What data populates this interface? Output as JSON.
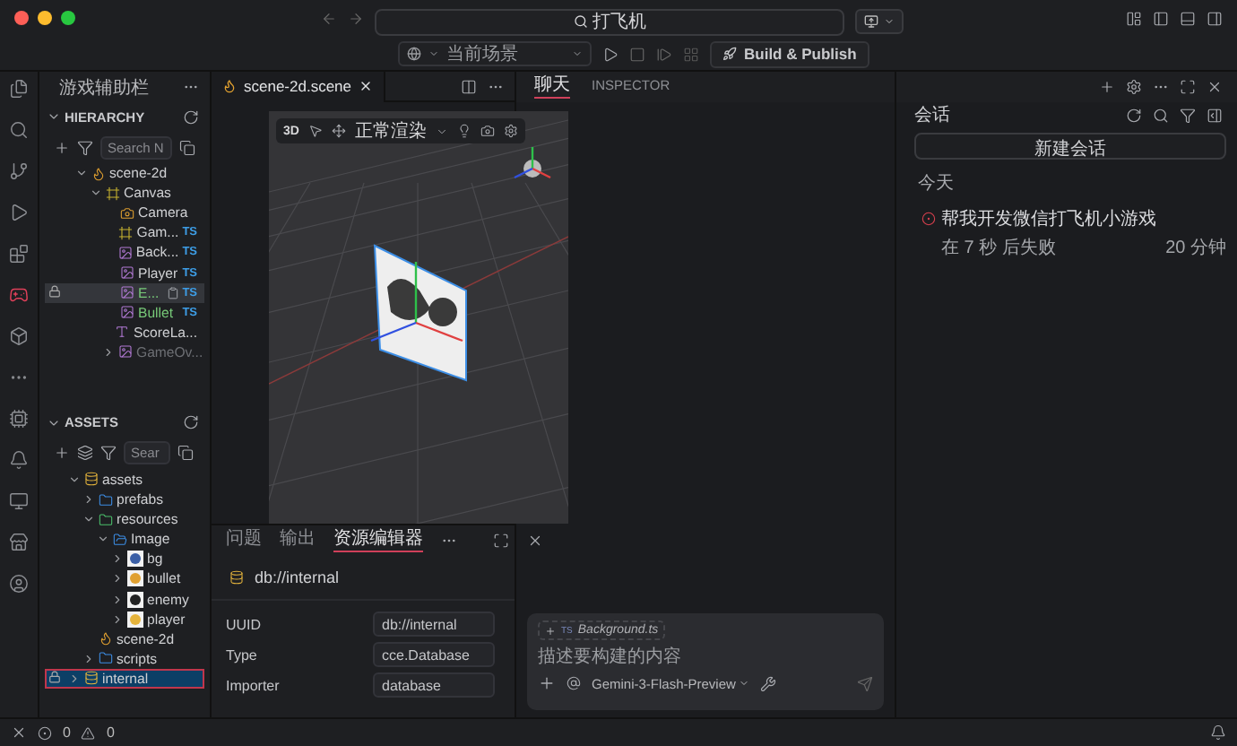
{
  "window": {
    "search": "打飞机"
  },
  "toolbar": {
    "scene_select": "当前场景",
    "build_button": "Build & Publish"
  },
  "activity_bar": [
    {
      "kind": "files",
      "selected": false
    },
    {
      "kind": "search",
      "selected": false
    },
    {
      "kind": "source",
      "selected": false
    },
    {
      "kind": "run",
      "selected": false
    },
    {
      "kind": "extensions",
      "selected": false
    },
    {
      "kind": "game",
      "selected": true
    },
    {
      "kind": "cube",
      "selected": false
    },
    {
      "kind": "more",
      "selected": false
    },
    {
      "kind": "chip",
      "selected": false
    },
    {
      "kind": "bell",
      "selected": false
    },
    {
      "kind": "monitor",
      "selected": false
    },
    {
      "kind": "store",
      "selected": false
    },
    {
      "kind": "account",
      "selected": false
    }
  ],
  "side_panel": {
    "title": "游戏辅助栏"
  },
  "hierarchy": {
    "title": "HIERARCHY",
    "search_placeholder": "Search N",
    "nodes": [
      {
        "label": "scene-2d",
        "kind": "scene",
        "expanded": true,
        "selected": false,
        "prefab": false,
        "active": true,
        "children": [
          {
            "label": "Canvas",
            "kind": "canvas",
            "expanded": true,
            "selected": false,
            "prefab": false,
            "active": true,
            "children": [
              {
                "label": "Camera",
                "kind": "camera",
                "selected": false,
                "prefab": false,
                "active": true
              },
              {
                "label": "Gam...",
                "kind": "canvas",
                "selected": false,
                "prefab": false,
                "active": true,
                "badge": "TS"
              },
              {
                "label": "Back...",
                "kind": "sprite",
                "selected": false,
                "prefab": false,
                "active": true,
                "badge": "TS"
              },
              {
                "label": "Player",
                "kind": "sprite",
                "selected": false,
                "prefab": false,
                "active": true,
                "badge": "TS"
              },
              {
                "label": "E...",
                "kind": "sprite",
                "selected": true,
                "prefab": true,
                "active": true,
                "badge": "TS"
              },
              {
                "label": "Bullet",
                "kind": "sprite",
                "selected": false,
                "prefab": true,
                "active": true,
                "badge": "TS"
              },
              {
                "label": "ScoreLa...",
                "kind": "label",
                "selected": false,
                "prefab": false,
                "active": true
              },
              {
                "label": "GameOv...",
                "kind": "sprite",
                "expanded": false,
                "selected": false,
                "prefab": false,
                "active": false
              }
            ]
          }
        ]
      }
    ]
  },
  "assets": {
    "title": "ASSETS",
    "search_placeholder": "Sear",
    "nodes": [
      {
        "label": "assets",
        "kind": "db",
        "expanded": true,
        "selected": false,
        "children": [
          {
            "label": "prefabs",
            "kind": "folder",
            "expanded": false,
            "selected": false
          },
          {
            "label": "resources",
            "kind": "folder-res",
            "expanded": true,
            "selected": false,
            "children": [
              {
                "label": "Image",
                "kind": "folder-open",
                "expanded": true,
                "selected": false,
                "children": [
                  {
                    "label": "bg",
                    "kind": "tex-planet",
                    "expanded": false,
                    "selected": false
                  },
                  {
                    "label": "bullet",
                    "kind": "tex-bullet",
                    "expanded": false,
                    "selected": false
                  },
                  {
                    "label": "enemy",
                    "kind": "tex-enemy",
                    "expanded": false,
                    "selected": false
                  },
                  {
                    "label": "player",
                    "kind": "tex-player",
                    "expanded": false,
                    "selected": false
                  }
                ]
              }
            ]
          },
          {
            "label": "scene-2d",
            "kind": "scene",
            "selected": false
          },
          {
            "label": "scripts",
            "kind": "folder",
            "expanded": false,
            "selected": false
          }
        ]
      },
      {
        "label": "internal",
        "kind": "db",
        "expanded": false,
        "selected": true
      }
    ]
  },
  "editor": {
    "tabs": [
      {
        "label": "scene-2d.scene",
        "selected": true
      }
    ],
    "scene_toolbar": {
      "mode": "3D",
      "render_mode": "正常渲染"
    }
  },
  "bottom_panel": {
    "tabs": [
      {
        "label": "问题",
        "selected": false
      },
      {
        "label": "输出",
        "selected": false
      },
      {
        "label": "资源编辑器",
        "selected": true
      }
    ],
    "asset_path": "db://internal",
    "properties": [
      {
        "label": "UUID",
        "value": "db://internal"
      },
      {
        "label": "Type",
        "value": "cce.Database"
      },
      {
        "label": "Importer",
        "value": "database"
      }
    ]
  },
  "chat": {
    "tabs": [
      {
        "label": "聊天",
        "selected": true
      },
      {
        "label": "INSPECTOR",
        "selected": false
      }
    ],
    "attachment_badge": "TS",
    "attachment": "Background.ts",
    "placeholder": "描述要构建的内容",
    "model": "Gemini-3-Flash-Preview"
  },
  "sessions": {
    "title": "会话",
    "new_button": "新建会话",
    "groups": [
      {
        "label": "今天",
        "items": [
          {
            "title": "帮我开发微信打飞机小游戏",
            "status": "在 7 秒 后失败",
            "time": "20 分钟",
            "failed": true
          }
        ]
      }
    ]
  },
  "status_bar": {
    "errors": "0",
    "warnings": "0"
  }
}
